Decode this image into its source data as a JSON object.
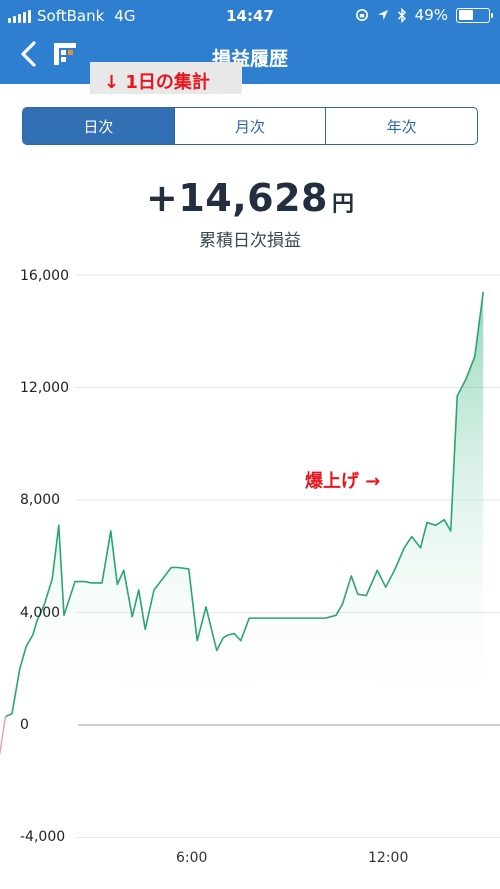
{
  "status_bar": {
    "carrier": "SoftBank",
    "network": "4G",
    "time": "14:47",
    "battery": "49%",
    "battery_level": 0.49
  },
  "nav": {
    "title": "損益履歴",
    "back_icon": "chevron-left-icon",
    "logo_icon": "app-logo-icon"
  },
  "annotation": {
    "period_note": "↓ 1日の集計",
    "chart_note": "爆上げ →"
  },
  "tabs": [
    {
      "label": "日次",
      "active": true
    },
    {
      "label": "月次",
      "active": false
    },
    {
      "label": "年次",
      "active": false
    }
  ],
  "summary": {
    "amount": "+14,628",
    "unit": "円",
    "label": "累積日次損益"
  },
  "colors": {
    "header": "#2f7fd0",
    "line": "#2aa56e",
    "negative_line": "#e05a6a",
    "annotation": "#e8151c"
  },
  "chart_data": {
    "type": "area",
    "title": "",
    "xlabel": "",
    "ylabel": "",
    "ylim": [
      -4000,
      16000
    ],
    "y_ticks": [
      "16,000",
      "12,000",
      "8,000",
      "4,000",
      "0",
      "-4,000"
    ],
    "x_ticks": [
      "6:00",
      "12:00"
    ],
    "grid": true,
    "x": [
      -0.37,
      -0.23,
      -0.07,
      0.07,
      0.23,
      0.43,
      0.67,
      0.87,
      1.07,
      1.2,
      1.43,
      1.67,
      1.87,
      2.03,
      2.37,
      2.67,
      2.87,
      3.2,
      3.47,
      3.67,
      3.87,
      4.13,
      4.33,
      4.53,
      4.8,
      5.0,
      5.33,
      5.53,
      5.87,
      6.13,
      6.4,
      6.73,
      6.93,
      7.07,
      7.27,
      7.47,
      7.73,
      8.07,
      8.4,
      8.73,
      9.07,
      9.4,
      9.73,
      10.07,
      10.4,
      10.6,
      10.87,
      11.07,
      11.33,
      11.67,
      11.93,
      12.2,
      12.5,
      12.73,
      13.0,
      13.2,
      13.47,
      13.73,
      13.93,
      14.13,
      14.4,
      14.67,
      14.93,
      15.13,
      15.4,
      15.67,
      16.0,
      16.2,
      16.67,
      16.87,
      17.2,
      17.53
    ],
    "values": [
      -1400,
      -1600,
      -1800,
      -900,
      300,
      400,
      2000,
      2800,
      3200,
      3700,
      4300,
      5200,
      7100,
      3900,
      5100,
      5100,
      5050,
      5050,
      6900,
      5000,
      5500,
      3850,
      4800,
      3400,
      4800,
      5100,
      5600,
      5600,
      5550,
      3000,
      4200,
      2650,
      3100,
      3200,
      3250,
      3000,
      3800,
      3800,
      3800,
      3800,
      3800,
      3800,
      3800,
      3800,
      3900,
      4300,
      5300,
      4650,
      4600,
      5500,
      4900,
      5500,
      6300,
      6700,
      6300,
      7200,
      7100,
      7300,
      6900,
      11700,
      12300,
      13100,
      15400
    ]
  }
}
